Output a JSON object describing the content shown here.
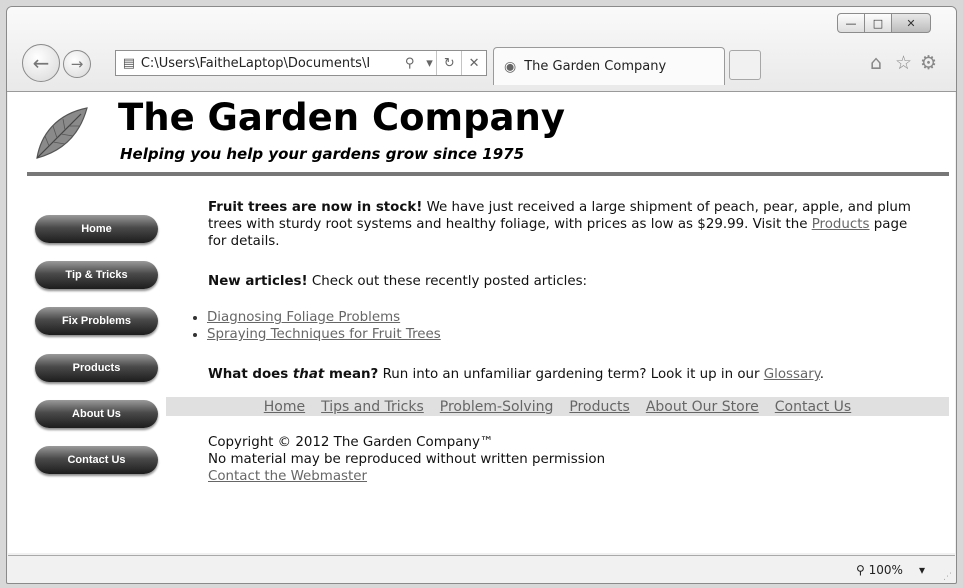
{
  "browser": {
    "address": "C:\\Users\\FaitheLaptop\\Documents\\I",
    "tab_title": "The Garden Company",
    "zoom": "100%",
    "icons": {
      "back": "back-arrow-icon",
      "forward": "forward-arrow-icon",
      "search": "search-icon",
      "refresh": "refresh-icon",
      "stop": "close-icon",
      "home": "home-icon",
      "favorites": "star-icon",
      "tools": "gear-icon"
    }
  },
  "site": {
    "title": "The Garden Company",
    "tagline": "Helping you help your gardens grow since 1975"
  },
  "nav": [
    {
      "label": "Home"
    },
    {
      "label": "Tip & Tricks"
    },
    {
      "label": "Fix Problems"
    },
    {
      "label": "Products"
    },
    {
      "label": "About Us"
    },
    {
      "label": "Contact Us"
    }
  ],
  "main": {
    "p1_bold": "Fruit trees are now in stock!",
    "p1_text": " We have just received a large shipment of peach, pear, apple, and plum trees with sturdy root systems and healthy foliage, with prices as low as $29.99. Visit the ",
    "p1_link": "Products",
    "p1_end": " page for details.",
    "p2_bold": "New articles!",
    "p2_text": " Check out these recently posted articles:",
    "articles": [
      "Diagnosing Foliage Problems",
      "Spraying Techniques for Fruit Trees"
    ],
    "p3_bold1": "What does ",
    "p3_italic": "that",
    "p3_bold2": " mean?",
    "p3_text": " Run into an unfamiliar gardening term? Look it up in our ",
    "p3_link": "Glossary",
    "p3_end": "."
  },
  "footer_links": [
    "Home",
    "Tips and Tricks",
    "Problem-Solving",
    "Products",
    "About Our Store",
    "Contact Us"
  ],
  "copyright": {
    "line1": "Copyright © 2012 The Garden Company™",
    "line2": "No material may be reproduced without written permission",
    "link": "Contact the Webmaster"
  }
}
